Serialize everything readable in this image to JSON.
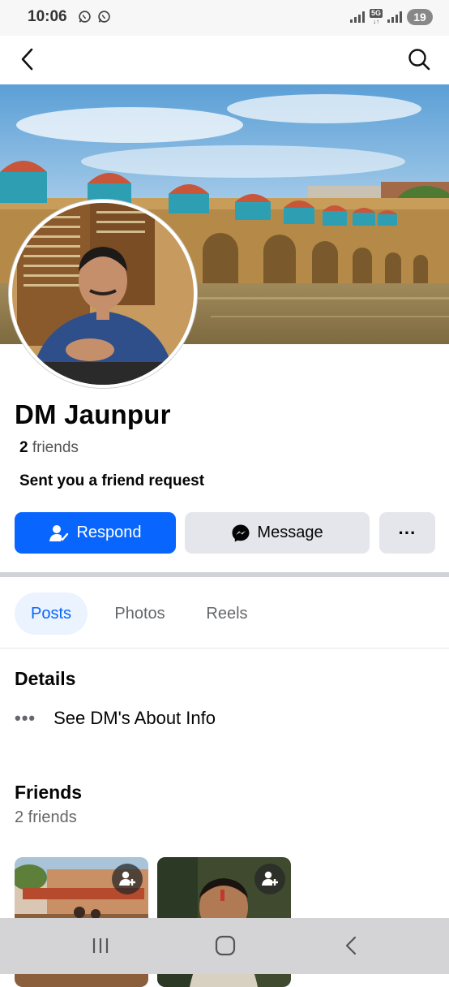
{
  "status_bar": {
    "time": "10:06",
    "network": "5G",
    "battery": "19",
    "icons": [
      "whatsapp-icon",
      "whatsapp-icon",
      "signal-icon",
      "signal-icon"
    ]
  },
  "header": {
    "back_icon": "back-arrow-icon",
    "search_icon": "search-icon"
  },
  "profile": {
    "name": "DM Jaunpur",
    "friend_count_number": "2",
    "friend_count_label": "friends",
    "request_status": "Sent you a friend request"
  },
  "actions": {
    "respond_label": "Respond",
    "message_label": "Message",
    "more_label": "···"
  },
  "tabs": [
    {
      "label": "Posts",
      "active": true
    },
    {
      "label": "Photos",
      "active": false
    },
    {
      "label": "Reels",
      "active": false
    }
  ],
  "details": {
    "title": "Details",
    "about_label": "See DM's About Info"
  },
  "friends": {
    "title": "Friends",
    "subtitle": "2 friends"
  },
  "colors": {
    "accent": "#0866ff",
    "button_gray": "#e4e6eb",
    "tab_active_bg": "#ebf3ff",
    "text_secondary": "#65676b"
  }
}
